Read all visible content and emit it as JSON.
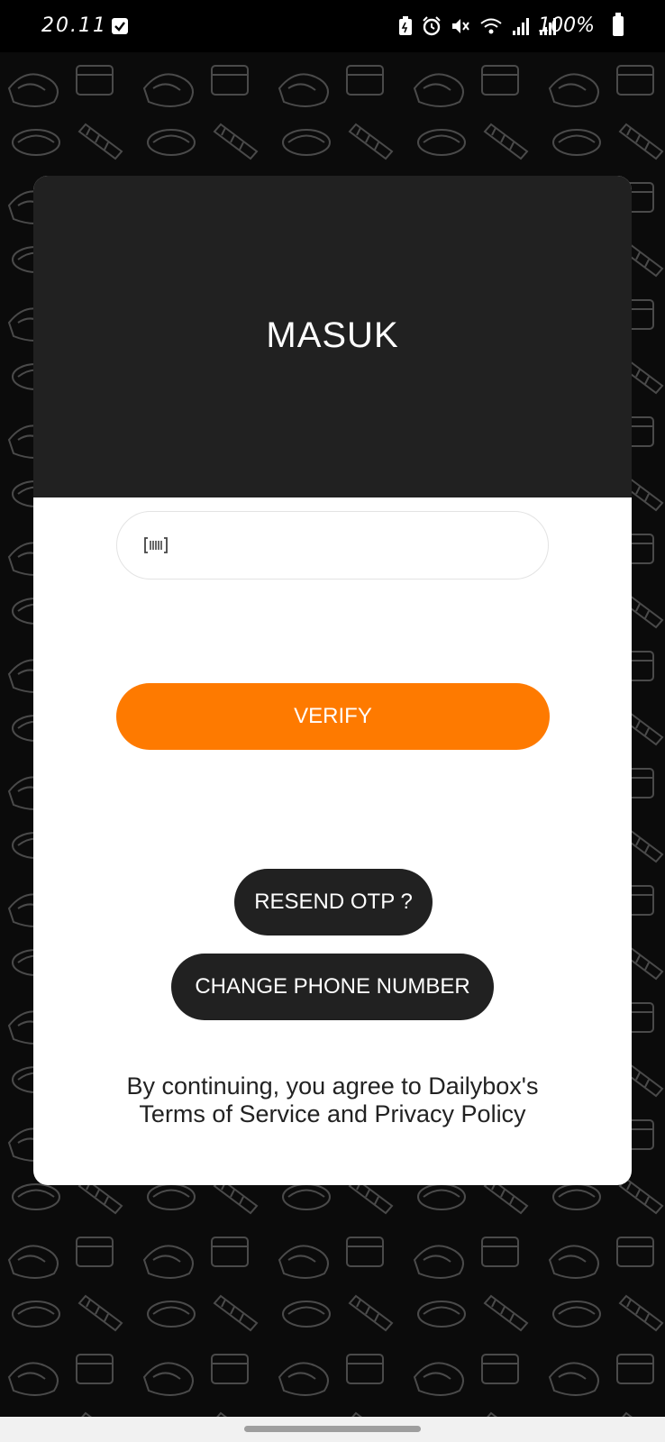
{
  "status_bar": {
    "time": "20.11",
    "battery": "100%"
  },
  "card": {
    "title": "MASUK",
    "otp_input": {
      "value": "",
      "placeholder": ""
    },
    "verify_label": "VERIFY",
    "resend_label": "RESEND OTP ?",
    "change_phone_label": "CHANGE PHONE NUMBER",
    "terms": "By continuing, you agree to Dailybox's Terms of Service and Privacy Policy"
  },
  "colors": {
    "accent": "#fe7a00",
    "header_dark": "#212121",
    "background": "#0b0b0b"
  },
  "icons": {
    "otp_field_icon": "barcode-icon",
    "status": [
      "checkbox-icon",
      "alarm-icon",
      "mute-icon",
      "wifi-icon",
      "signal-icon",
      "signal-icon",
      "battery-icon"
    ]
  }
}
